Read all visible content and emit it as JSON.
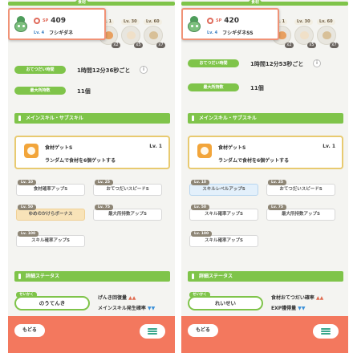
{
  "left": {
    "top_tag": "食材",
    "sp_label": "SP",
    "sp_value": "409",
    "level": "Lv. 4",
    "pokemon_name": "フシギダネ",
    "ingredients": [
      {
        "lv": "Lv. 1",
        "qty": "x2",
        "color": "#e8a060"
      },
      {
        "lv": "Lv. 30",
        "qty": "x5",
        "color": "#f0e0c8"
      },
      {
        "lv": "Lv. 60",
        "qty": "x7",
        "color": "#d8c098"
      }
    ],
    "help_label": "おてつだい時間",
    "help_value": "1時間12分36秒ごと",
    "carry_label": "最大所持数",
    "carry_value": "11個",
    "section_skill": "メインスキル・サブスキル",
    "main_skill_name": "食材ゲットS",
    "main_skill_lv": "Lv. 1",
    "main_skill_desc": "ランダムで食材を6個ゲットする",
    "sub_skills": [
      {
        "lv": "Lv. 10",
        "name": "食材確率アップS",
        "style": ""
      },
      {
        "lv": "Lv. 25",
        "name": "おてつだいスピードS",
        "style": ""
      },
      {
        "lv": "Lv. 50",
        "name": "ゆめのかけらボーナス",
        "style": "gold"
      },
      {
        "lv": "Lv. 75",
        "name": "最大所持数アップS",
        "style": ""
      },
      {
        "lv": "Lv. 100",
        "name": "スキル確率アップS",
        "style": ""
      }
    ],
    "section_detail": "詳細ステータス",
    "trait_lv": "せいかく",
    "trait_name": "のうてんき",
    "stat_up": "げんき回復量",
    "stat_down": "メインスキル発生確率",
    "back_label": "もどる",
    "info_icon": "i"
  },
  "right": {
    "top_tag": "食材",
    "sp_label": "SP",
    "sp_value": "420",
    "level": "Lv. 4",
    "pokemon_name": "フシギダネSS",
    "ingredients": [
      {
        "lv": "Lv. 1",
        "qty": "x2",
        "color": "#e8a060"
      },
      {
        "lv": "Lv. 30",
        "qty": "x5",
        "color": "#f0e0c8"
      },
      {
        "lv": "Lv. 60",
        "qty": "x7",
        "color": "#d8c098"
      }
    ],
    "help_label": "おてつだい時間",
    "help_value": "1時間12分53秒ごと",
    "carry_label": "最大所持数",
    "carry_value": "11個",
    "section_skill": "メインスキル・サブスキル",
    "main_skill_name": "食材ゲットS",
    "main_skill_lv": "Lv. 1",
    "main_skill_desc": "ランダムで食材を6個ゲットする",
    "sub_skills": [
      {
        "lv": "Lv. 10",
        "name": "スキルレベルアップS",
        "style": "blue"
      },
      {
        "lv": "Lv. 25",
        "name": "おてつだいスピードS",
        "style": ""
      },
      {
        "lv": "Lv. 50",
        "name": "スキル確率アップS",
        "style": ""
      },
      {
        "lv": "Lv. 75",
        "name": "最大所持数アップS",
        "style": ""
      },
      {
        "lv": "Lv. 100",
        "name": "スキル確率アップS",
        "style": ""
      }
    ],
    "section_detail": "詳細ステータス",
    "trait_lv": "せいかく",
    "trait_name": "れいせい",
    "stat_up": "食材おてつだい確率",
    "stat_down": "EXP獲得量",
    "back_label": "もどる",
    "info_icon": "i"
  },
  "colors": {
    "accent_green": "#7fc44a",
    "bottom_bar": "#f3785e",
    "card_border": "#f09377",
    "skill_border": "#e8ca70",
    "arrow_up": "#e06b50",
    "arrow_down": "#3a8fd8"
  }
}
